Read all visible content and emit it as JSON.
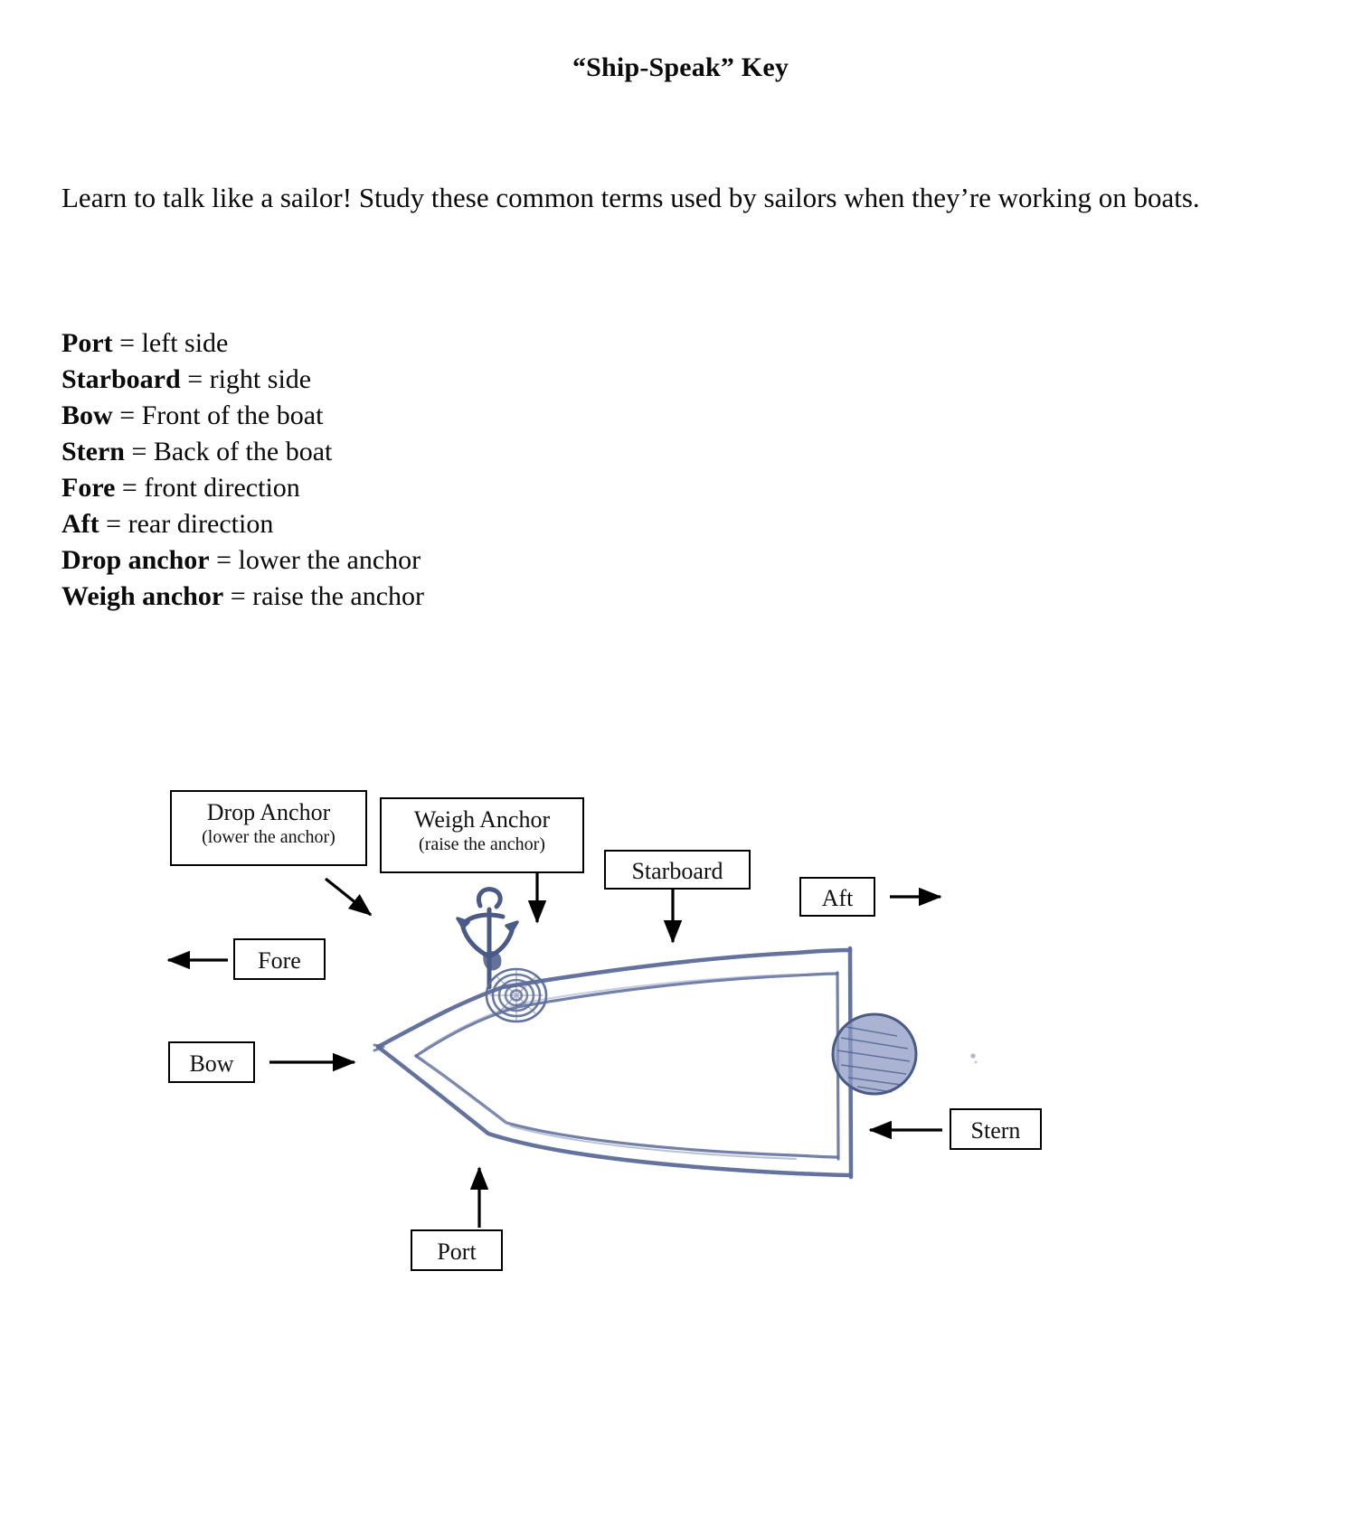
{
  "document": {
    "title": "“Ship-Speak” Key",
    "intro": "Learn to talk like a sailor! Study these common terms used by sailors when they’re working on boats."
  },
  "vocabulary": {
    "separator": " = ",
    "entries": [
      {
        "term": "Port",
        "definition": "left side"
      },
      {
        "term": "Starboard",
        "definition": "right side"
      },
      {
        "term": "Bow",
        "definition": "Front of the boat"
      },
      {
        "term": "Stern",
        "definition": "Back of the boat"
      },
      {
        "term": "Fore",
        "definition": "front direction"
      },
      {
        "term": "Aft",
        "definition": "rear direction"
      },
      {
        "term": "Drop anchor",
        "definition": "lower the anchor"
      },
      {
        "term": "Weigh anchor",
        "definition": "raise the anchor"
      }
    ]
  },
  "diagram": {
    "description": "Hand-drawn top-view sketch of a boat in blue-gray pencil with labeled callout boxes and arrows",
    "drawing_color": "#5b6b99",
    "drawing_color_light": "#8c99bd",
    "labels": {
      "drop_anchor": {
        "main": "Drop Anchor",
        "sub": "(lower the anchor)"
      },
      "weigh_anchor": {
        "main": "Weigh Anchor",
        "sub": "(raise the anchor)"
      },
      "starboard": {
        "main": "Starboard"
      },
      "aft": {
        "main": "Aft"
      },
      "fore": {
        "main": "Fore"
      },
      "bow": {
        "main": "Bow"
      },
      "stern": {
        "main": "Stern"
      },
      "port": {
        "main": "Port"
      }
    }
  }
}
